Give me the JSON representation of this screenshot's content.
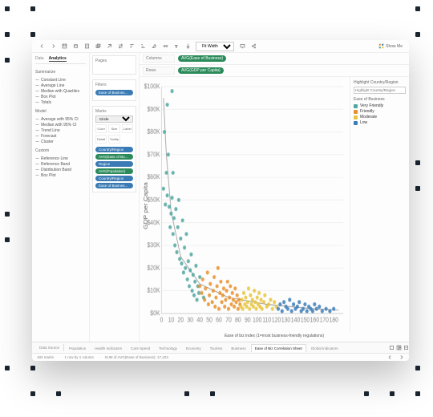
{
  "toolbar": {
    "fit_select": "Fit Width",
    "showme": "Show Me"
  },
  "side": {
    "tabData": "Data",
    "tabAnalytics": "Analytics",
    "sections": {
      "summarize": {
        "title": "Summarize",
        "items": [
          "Constant Line",
          "Average Line",
          "Median with Quartiles",
          "Box Plot",
          "Totals"
        ]
      },
      "model": {
        "title": "Model",
        "items": [
          "Average with 95% CI",
          "Median with 95% CI",
          "Trend Line",
          "Forecast",
          "Cluster"
        ]
      },
      "custom": {
        "title": "Custom",
        "items": [
          "Reference Line",
          "Reference Band",
          "Distribution Band",
          "Box Plot"
        ]
      }
    }
  },
  "cards": {
    "pages": "Pages",
    "filters": "Filters",
    "filters_items": [
      "Ease of Business (g..."
    ],
    "marks": "Marks",
    "marks_shape": "Circle",
    "marks_btns": [
      "Color",
      "Size",
      "Label",
      "Detail",
      "Tooltip"
    ],
    "marks_pills": [
      {
        "label": "Country/Region",
        "cls": "blue"
      },
      {
        "label": "AVG(Ease of Busi...",
        "cls": "green"
      },
      {
        "label": "Region",
        "cls": "blue"
      },
      {
        "label": "AVG(Population)",
        "cls": "green"
      },
      {
        "label": "Country/Region",
        "cls": "blue"
      },
      {
        "label": "Ease of Busines...",
        "cls": "blue"
      }
    ]
  },
  "shelves": {
    "columns_label": "Columns",
    "columns_pill": "AVG(Ease of Business)",
    "rows_label": "Rows",
    "rows_pill": "AVG(GDP per Capita)"
  },
  "legend": {
    "highlight_title": "Highlight Country/Region",
    "highlight_placeholder": "Highlight Country/Region",
    "color_title": "Ease of Business",
    "items": [
      {
        "label": "Very Friendly",
        "color": "#4fa7a0"
      },
      {
        "label": "Friendly",
        "color": "#e8902b"
      },
      {
        "label": "Moderate",
        "color": "#e8c43b"
      },
      {
        "label": "Low",
        "color": "#3b7db8"
      }
    ]
  },
  "sheets": {
    "datasource": "Data Source",
    "tabs": [
      "Population",
      "Health Indicators",
      "Care Spend",
      "Technology",
      "Economy",
      "Tourism",
      "Business",
      "Ease of Biz Correlation Sheet",
      "Global Indicators"
    ],
    "active": 7
  },
  "status": {
    "marks": "183 marks",
    "rc": "1 row by 1 column",
    "sum": "SUM of AVG(Ease of Business): 17,423",
    "right": ""
  },
  "chart_data": {
    "type": "scatter",
    "title": "",
    "xlabel": "Ease of biz index (1=most business-friendly regulations)",
    "ylabel": "GDP per Capita",
    "xlim": [
      0,
      190
    ],
    "ylim": [
      0,
      100000
    ],
    "xticks": [
      0,
      10,
      20,
      30,
      40,
      50,
      60,
      70,
      80,
      90,
      100,
      110,
      120,
      130,
      140,
      150,
      160,
      170,
      180
    ],
    "yticks_labels": [
      "$0K",
      "$10K",
      "$20K",
      "$30K",
      "$40K",
      "$50K",
      "$60K",
      "$70K",
      "$80K",
      "$90K",
      "$100K"
    ],
    "series": [
      {
        "name": "Very Friendly",
        "color": "#4fa7a0",
        "points": [
          [
            2,
            55
          ],
          [
            3,
            80
          ],
          [
            4,
            48
          ],
          [
            5,
            62
          ],
          [
            6,
            92
          ],
          [
            6,
            52
          ],
          [
            7,
            70
          ],
          [
            8,
            47
          ],
          [
            9,
            38
          ],
          [
            10,
            44
          ],
          [
            11,
            51
          ],
          [
            12,
            62
          ],
          [
            12,
            35
          ],
          [
            13,
            42
          ],
          [
            14,
            30
          ],
          [
            15,
            46
          ],
          [
            16,
            27
          ],
          [
            17,
            38
          ],
          [
            18,
            50
          ],
          [
            19,
            24
          ],
          [
            20,
            33
          ],
          [
            21,
            22
          ],
          [
            22,
            41
          ],
          [
            23,
            18
          ],
          [
            24,
            29
          ],
          [
            25,
            20
          ],
          [
            26,
            35
          ],
          [
            27,
            15
          ],
          [
            28,
            23
          ],
          [
            29,
            12
          ],
          [
            30,
            19
          ],
          [
            31,
            26
          ],
          [
            32,
            10
          ],
          [
            33,
            17
          ],
          [
            34,
            8
          ],
          [
            35,
            14
          ],
          [
            36,
            21
          ],
          [
            37,
            6
          ],
          [
            38,
            12
          ],
          [
            39,
            9
          ],
          [
            40,
            16
          ],
          [
            44,
            7
          ],
          [
            11,
            98
          ]
        ]
      },
      {
        "name": "Friendly",
        "color": "#e8902b",
        "points": [
          [
            40,
            12
          ],
          [
            42,
            9
          ],
          [
            43,
            15
          ],
          [
            45,
            6
          ],
          [
            46,
            11
          ],
          [
            48,
            18
          ],
          [
            49,
            4
          ],
          [
            50,
            8
          ],
          [
            51,
            13
          ],
          [
            53,
            5
          ],
          [
            54,
            10
          ],
          [
            55,
            16
          ],
          [
            56,
            3
          ],
          [
            57,
            7
          ],
          [
            58,
            12
          ],
          [
            59,
            20
          ],
          [
            60,
            2
          ],
          [
            61,
            9
          ],
          [
            62,
            14
          ],
          [
            63,
            5
          ],
          [
            64,
            8
          ],
          [
            65,
            11
          ],
          [
            66,
            3
          ],
          [
            67,
            6
          ],
          [
            68,
            10
          ],
          [
            69,
            14
          ],
          [
            70,
            2
          ],
          [
            71,
            7
          ],
          [
            72,
            12
          ],
          [
            73,
            4
          ],
          [
            74,
            9
          ],
          [
            75,
            6
          ],
          [
            76,
            3
          ],
          [
            77,
            11
          ],
          [
            78,
            5
          ],
          [
            79,
            8
          ],
          [
            80,
            2
          ],
          [
            81,
            6
          ],
          [
            82,
            4
          ]
        ]
      },
      {
        "name": "Moderate",
        "color": "#e8c43b",
        "points": [
          [
            83,
            3
          ],
          [
            84,
            6
          ],
          [
            85,
            2
          ],
          [
            86,
            9
          ],
          [
            87,
            4
          ],
          [
            88,
            7
          ],
          [
            89,
            3
          ],
          [
            90,
            5
          ],
          [
            91,
            11
          ],
          [
            92,
            2
          ],
          [
            93,
            8
          ],
          [
            94,
            4
          ],
          [
            95,
            6
          ],
          [
            96,
            3
          ],
          [
            97,
            10
          ],
          [
            98,
            5
          ],
          [
            99,
            2
          ],
          [
            100,
            7
          ],
          [
            101,
            4
          ],
          [
            102,
            9
          ],
          [
            103,
            3
          ],
          [
            104,
            6
          ],
          [
            105,
            2
          ],
          [
            107,
            5
          ],
          [
            108,
            8
          ],
          [
            110,
            3
          ],
          [
            112,
            4
          ],
          [
            114,
            6
          ],
          [
            116,
            2
          ],
          [
            118,
            5
          ],
          [
            120,
            3
          ]
        ]
      },
      {
        "name": "Low",
        "color": "#3b7db8",
        "points": [
          [
            122,
            2
          ],
          [
            124,
            4
          ],
          [
            126,
            1
          ],
          [
            128,
            5
          ],
          [
            130,
            3
          ],
          [
            132,
            2
          ],
          [
            134,
            6
          ],
          [
            136,
            1
          ],
          [
            138,
            4
          ],
          [
            140,
            2
          ],
          [
            142,
            3
          ],
          [
            144,
            5
          ],
          [
            146,
            1
          ],
          [
            148,
            2
          ],
          [
            150,
            4
          ],
          [
            152,
            1
          ],
          [
            154,
            3
          ],
          [
            156,
            2
          ],
          [
            158,
            1
          ],
          [
            160,
            4
          ],
          [
            162,
            2
          ],
          [
            165,
            3
          ],
          [
            168,
            1
          ],
          [
            172,
            2
          ],
          [
            176,
            1
          ],
          [
            180,
            2
          ]
        ]
      }
    ],
    "trend": {
      "type": "power",
      "points": [
        [
          2,
          95
        ],
        [
          5,
          70
        ],
        [
          10,
          45
        ],
        [
          20,
          25
        ],
        [
          40,
          13
        ],
        [
          70,
          7
        ],
        [
          110,
          4
        ],
        [
          160,
          2
        ],
        [
          185,
          1.5
        ]
      ]
    }
  }
}
